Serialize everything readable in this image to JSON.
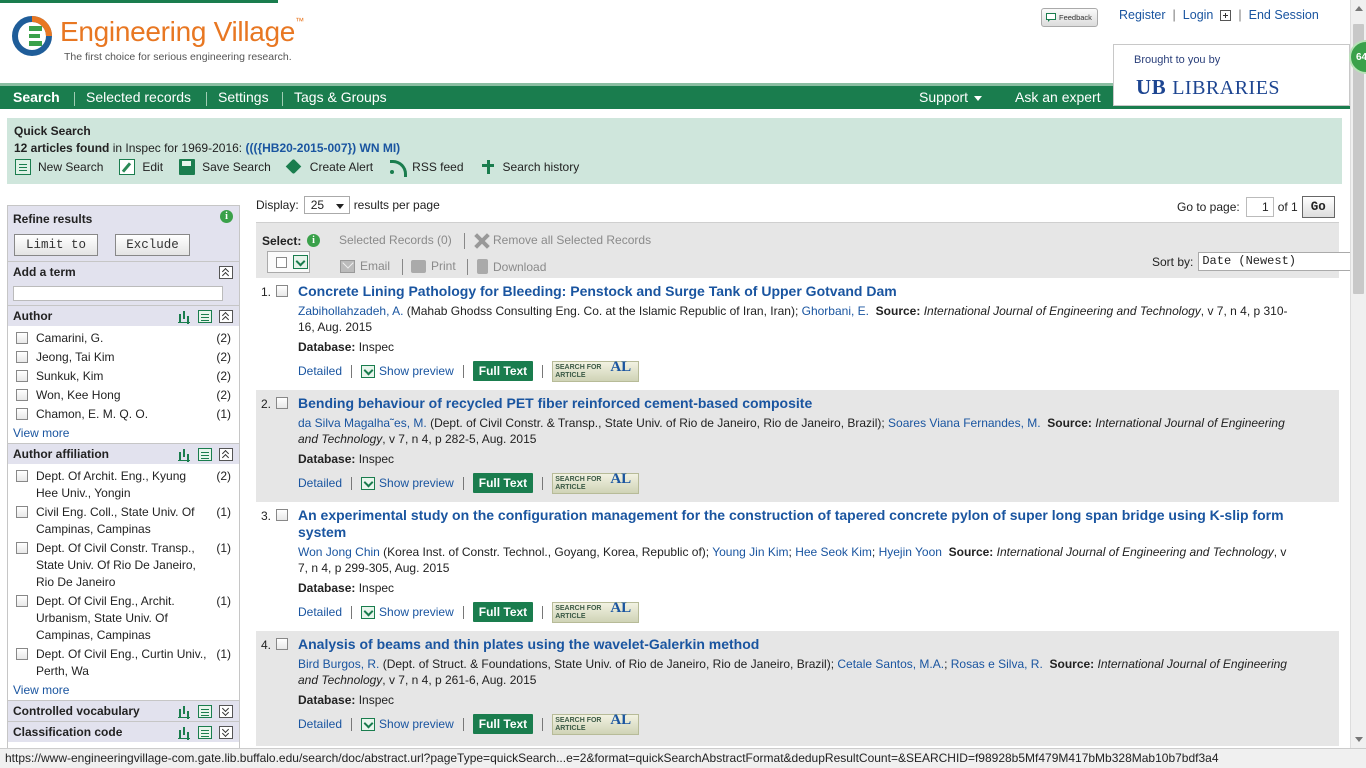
{
  "header": {
    "logo_title": "Engineering Village",
    "logo_tm": "™",
    "tagline": "The first choice for serious engineering research.",
    "feedback_label": "Feedback",
    "links": {
      "register": "Register",
      "login": "Login",
      "end_session": "End Session"
    },
    "brought_by": "Brought to you by",
    "brought_logo_ub": "UB",
    "brought_logo_text": "LIBRARIES",
    "badge": "64"
  },
  "nav": {
    "search": "Search",
    "selected_records": "Selected records",
    "settings": "Settings",
    "tags_groups": "Tags & Groups",
    "support": "Support",
    "ask_expert": "Ask an expert"
  },
  "quick_search": {
    "title": "Quick Search",
    "count_text": "12 articles found",
    "database_text": " in Inspec for 1969-2016: ",
    "query": "((({HB20-2015-007}) WN MI)",
    "actions": {
      "new_search": "New Search",
      "edit": "Edit",
      "save_search": "Save Search",
      "create_alert": "Create Alert",
      "rss": "RSS feed",
      "history": "Search history"
    }
  },
  "sidebar": {
    "refine_title": "Refine results",
    "limit_to": "Limit to",
    "exclude": "Exclude",
    "add_term": "Add a term",
    "author_title": "Author",
    "authors": [
      {
        "name": "Camarini, G.",
        "count": "(2)"
      },
      {
        "name": "Jeong, Tai Kim",
        "count": "(2)"
      },
      {
        "name": "Sunkuk, Kim",
        "count": "(2)"
      },
      {
        "name": "Won, Kee Hong",
        "count": "(2)"
      },
      {
        "name": "Chamon, E. M. Q. O.",
        "count": "(1)"
      }
    ],
    "view_more": "View more",
    "affiliation_title": "Author affiliation",
    "affiliations": [
      {
        "name": "Dept. Of Archit. Eng., Kyung Hee Univ., Yongin",
        "count": "(2)"
      },
      {
        "name": "Civil Eng. Coll., State Univ. Of Campinas, Campinas",
        "count": "(1)"
      },
      {
        "name": "Dept. Of Civil Constr. Transp., State Univ. Of Rio De Janeiro, Rio De Janeiro",
        "count": "(1)"
      },
      {
        "name": "Dept. Of Civil Eng., Archit. Urbanism, State Univ. Of Campinas, Campinas",
        "count": "(1)"
      },
      {
        "name": "Dept. Of Civil Eng., Curtin Univ., Perth, Wa",
        "count": "(1)"
      }
    ],
    "controlled_vocab": "Controlled vocabulary",
    "classification_code": "Classification code"
  },
  "display": {
    "label": "Display:",
    "value": "25",
    "suffix": "results per page",
    "goto_label": "Go to page:",
    "page": "1",
    "of_text": "of 1",
    "go": "Go"
  },
  "toolbar": {
    "select_label": "Select:",
    "selected_records": "Selected Records (0)",
    "remove_all": "Remove all Selected Records",
    "email": "Email",
    "print": "Print",
    "download": "Download",
    "sort_label": "Sort by:",
    "sort_value": "Date (Newest)"
  },
  "result_links": {
    "detailed": "Detailed",
    "preview": "Show preview",
    "fulltext": "Full Text",
    "sfa_line1": "SEARCH FOR",
    "sfa_line2": "ARTICLE",
    "sfa_al": "AL",
    "db_label": "Database:",
    "source_label": "Source:"
  },
  "results": [
    {
      "num": "1.",
      "title": "Concrete Lining Pathology for Bleeding: Penstock and Surge Tank of Upper Gotvand Dam",
      "author1": "Zabihollahzadeh, A.",
      "affil1": " (Mahab Ghodss Consulting Eng. Co. at the Islamic Republic of Iran, Iran); ",
      "author2": "Ghorbani, E.",
      "source": "International Journal of Engineering and Technology",
      "details": ", v 7, n 4, p 310-16, Aug. 2015",
      "database": "Inspec"
    },
    {
      "num": "2.",
      "title": "Bending behaviour of recycled PET fiber reinforced cement-based composite",
      "author1": "da Silva Magalha˜es, M.",
      "affil1": " (Dept. of Civil Constr. & Transp., State Univ. of Rio de Janeiro, Rio de Janeiro, Brazil); ",
      "author2": "Soares Viana Fernandes, M.",
      "source": "International Journal of Engineering and Technology",
      "details": ", v 7, n 4, p 282-5, Aug. 2015",
      "database": "Inspec"
    },
    {
      "num": "3.",
      "title": "An experimental study on the configuration management for the construction of tapered concrete pylon of super long span bridge using K-slip form system",
      "author1": "Won Jong Chin",
      "affil1": " (Korea Inst. of Constr. Technol., Goyang, Korea, Republic of); ",
      "author2": "Young Jin Kim",
      "author3": "Hee Seok Kim",
      "author4": "Hyejin Yoon",
      "source": "International Journal of Engineering and Technology",
      "details": ", v 7, n 4, p 299-305, Aug. 2015",
      "database": "Inspec"
    },
    {
      "num": "4.",
      "title": "Analysis of beams and thin plates using the wavelet-Galerkin method",
      "author1": "Bird Burgos, R.",
      "affil1": " (Dept. of Struct. & Foundations, State Univ. of Rio de Janeiro, Rio de Janeiro, Brazil); ",
      "author2": "Cetale Santos, M.A.",
      "author3": "Rosas e Silva, R.",
      "source": "International Journal of Engineering and Technology",
      "details": ", v 7, n 4, p 261-6, Aug. 2015",
      "database": "Inspec"
    }
  ],
  "statusbar": "https://www-engineeringvillage-com.gate.lib.buffalo.edu/search/doc/abstract.url?pageType=quickSearch...e=2&format=quickSearchAbstractFormat&dedupResultCount=&SEARCHID=f98928b5Mf479M417bMb328Mab10b7bdf3a4",
  "colors": {
    "brand_green": "#1a7d4e",
    "link_blue": "#1a55a0",
    "logo_orange": "#e87722"
  }
}
